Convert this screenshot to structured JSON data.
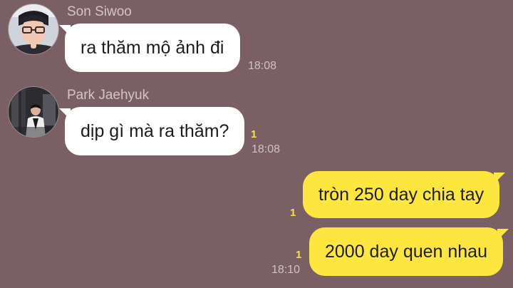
{
  "messages": [
    {
      "sender": "Son Siwoo",
      "text": "ra thăm mộ ảnh đi",
      "time": "18:08",
      "avatar": "profile-photo-man-with-glasses"
    },
    {
      "sender": "Park Jaehyuk",
      "text": "dịp gì mà ra thăm?",
      "time": "18:08",
      "unread": "1",
      "avatar": "profile-photo-man-in-dark-room"
    },
    {
      "text": "tròn 250 day chia tay",
      "unread": "1"
    },
    {
      "text": "2000 day quen nhau",
      "time": "18:10",
      "unread": "1"
    }
  ],
  "colors": {
    "background": "#7a6065",
    "incoming_bubble": "#ffffff",
    "outgoing_bubble": "#fde73e",
    "unread_count": "#f6e04b"
  }
}
